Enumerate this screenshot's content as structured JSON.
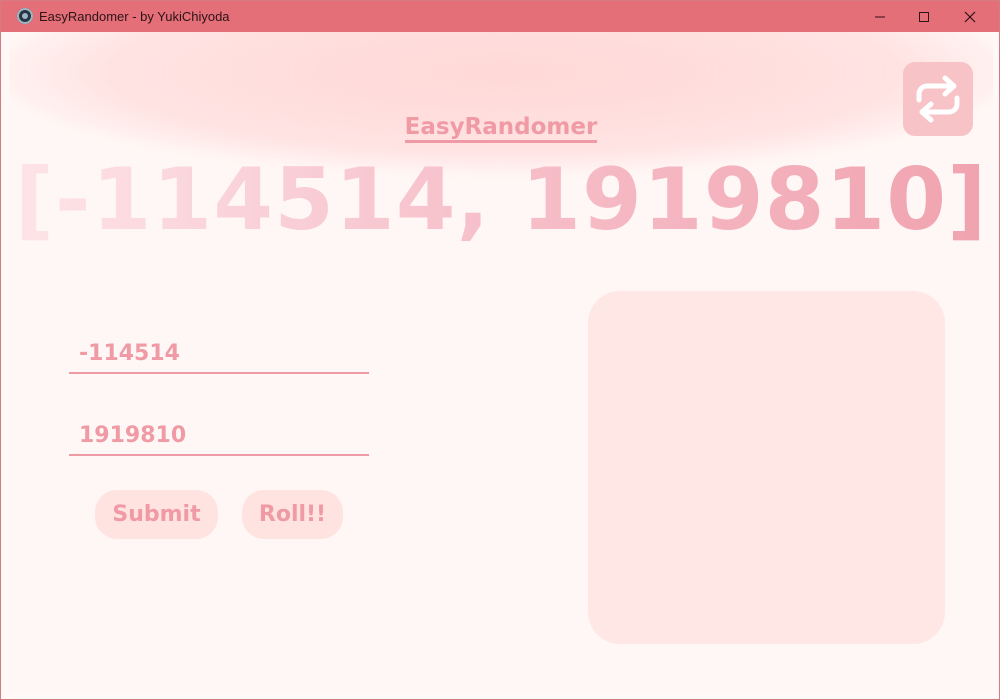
{
  "window": {
    "title": "EasyRandomer - by YukiChiyoda",
    "controls": {
      "minimize": "—",
      "maximize": "☐",
      "close": "✕"
    }
  },
  "app": {
    "title": "EasyRandomer",
    "range_display": "[-114514, 1919810]",
    "min_value": "-114514",
    "max_value": "1919810",
    "submit_label": "Submit",
    "roll_label": "Roll!!",
    "swap_icon": "repeat-icon",
    "result_text": ""
  },
  "colors": {
    "titlebar": "#e46f78",
    "accent": "#ef9aa4",
    "panel": "#ffe7e5",
    "background": "#fff7f5"
  }
}
